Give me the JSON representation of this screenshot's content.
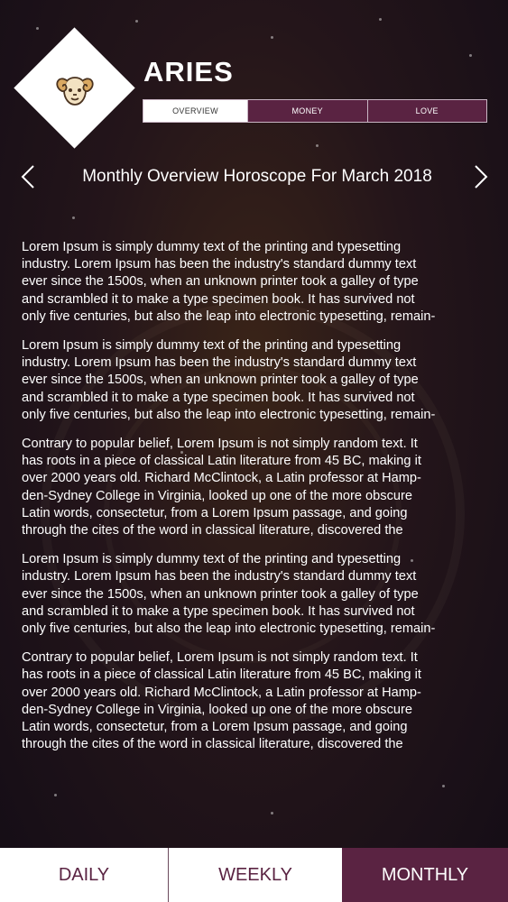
{
  "sign": {
    "name": "ARIES",
    "icon": "ram-head-icon"
  },
  "tabs": [
    {
      "label": "OVERVIEW",
      "active": true
    },
    {
      "label": "MONEY",
      "active": false
    },
    {
      "label": "LOVE",
      "active": false
    }
  ],
  "period_nav": {
    "title": "Monthly Overview Horoscope For March 2018",
    "prev_icon": "chevron-left-icon",
    "next_icon": "chevron-right-icon"
  },
  "paragraphs": [
    "Lorem Ipsum is simply dummy text of the printing and typesetting\nindustry. Lorem Ipsum has been the industry's standard dummy text\never since the 1500s, when an unknown printer took a galley of type\nand scrambled it to make a type specimen book. It has survived not\nonly five centuries, but also the leap into electronic typesetting, remain-",
    "Lorem Ipsum is simply dummy text of the printing and typesetting\nindustry. Lorem Ipsum has been the industry's standard dummy text\never since the 1500s, when an unknown printer took a galley of type\nand scrambled it to make a type specimen book. It has survived not\nonly five centuries, but also the leap into electronic typesetting, remain-",
    "Contrary to popular belief, Lorem Ipsum is not simply random text. It\nhas roots in a piece of classical Latin literature from 45 BC, making it\nover 2000 years old. Richard McClintock, a Latin professor at Hamp-\nden-Sydney College in Virginia, looked up one of the more obscure\nLatin words, consectetur, from a Lorem Ipsum passage, and going\nthrough the cites of the word in classical literature, discovered the",
    "Lorem Ipsum is simply dummy text of the printing and typesetting\nindustry. Lorem Ipsum has been the industry's standard dummy text\never since the 1500s, when an unknown printer took a galley of type\nand scrambled it to make a type specimen book. It has survived not\nonly five centuries, but also the leap into electronic typesetting, remain-",
    "Contrary to popular belief, Lorem Ipsum is not simply random text. It\nhas roots in a piece of classical Latin literature from 45 BC, making it\nover 2000 years old. Richard McClintock, a Latin professor at Hamp-\nden-Sydney College in Virginia, looked up one of the more obscure\nLatin words, consectetur, from a Lorem Ipsum passage, and going\nthrough the cites of the word in classical literature, discovered the"
  ],
  "bottom_tabs": [
    {
      "label": "DAILY",
      "active": false
    },
    {
      "label": "WEEKLY",
      "active": false
    },
    {
      "label": "MONTHLY",
      "active": true
    }
  ],
  "colors": {
    "accent": "#5a2342",
    "background": "#1d1218",
    "text": "#ffffff"
  }
}
